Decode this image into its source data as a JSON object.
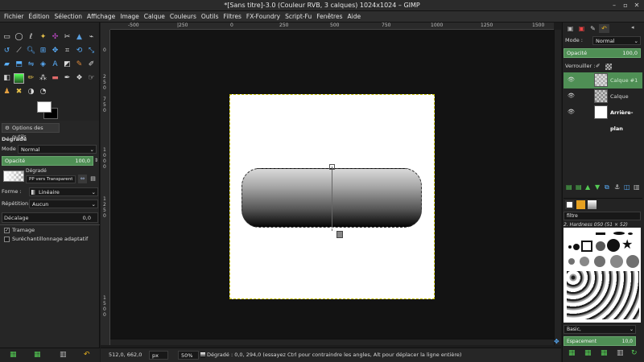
{
  "window": {
    "title": "*[Sans titre]-3.0 (Couleur RVB, 3 calques) 1024x1024 – GIMP"
  },
  "menubar": {
    "items": [
      "Fichier",
      "Édition",
      "Sélection",
      "Affichage",
      "Image",
      "Calque",
      "Couleurs",
      "Outils",
      "Filtres",
      "FX-Foundry",
      "Script-Fu",
      "Fenêtres",
      "Aide"
    ]
  },
  "tool_options": {
    "tab_label": "Options des outils",
    "tool_name": "Dégradé",
    "mode_label": "Mode :",
    "mode_value": "Normal",
    "opacity_label": "Opacité",
    "opacity_value": "100,0",
    "gradient_label": "Dégradé",
    "gradient_value": "PP vers Transparent",
    "shape_label": "Forme :",
    "shape_value": "Linéaire",
    "repeat_label": "Répétition :",
    "repeat_value": "Aucun",
    "offset_label": "Décalage",
    "offset_value": "0,0",
    "dither_label": "Tramage",
    "dither_checked": true,
    "adaptive_label": "Suréchantillonnage adaptatif",
    "adaptive_checked": false
  },
  "rulers": {
    "top": [
      "-500",
      "|250",
      "0",
      "250",
      "500",
      "750",
      "1000",
      "1250",
      "1500"
    ],
    "left": [
      "0",
      "2",
      "5",
      "0",
      "7",
      "5",
      "0",
      "1",
      "0",
      "0",
      "0",
      "1",
      "2",
      "5",
      "0",
      "1",
      "5",
      "0",
      "0"
    ]
  },
  "statusbar": {
    "coords": "512,0, 662,0",
    "unit": "px",
    "zoom": "50%",
    "message": "Dégradé : 0,0, 294,0 (essayez Ctrl pour contraindre les angles, Alt pour déplacer la ligne entière)"
  },
  "layers_panel": {
    "mode_label": "Mode :",
    "mode_value": "Normal",
    "opacity_label": "Opacité",
    "opacity_value": "100,0",
    "lock_label": "Verrouiller :",
    "layers": [
      {
        "name": "Calque #1",
        "active": true
      },
      {
        "name": "Calque",
        "active": false
      },
      {
        "name": "Arrière-plan",
        "active": false
      }
    ]
  },
  "brushes_panel": {
    "filter_label": "filtre",
    "brush_name": "2. Hardness 050 (51 × 52)",
    "preset": "Basic,",
    "spacing_label": "Espacement",
    "spacing_value": "10,0"
  },
  "colors": {
    "accent": "#4f8f55",
    "fg": "#ffffff",
    "bg": "#000000"
  }
}
